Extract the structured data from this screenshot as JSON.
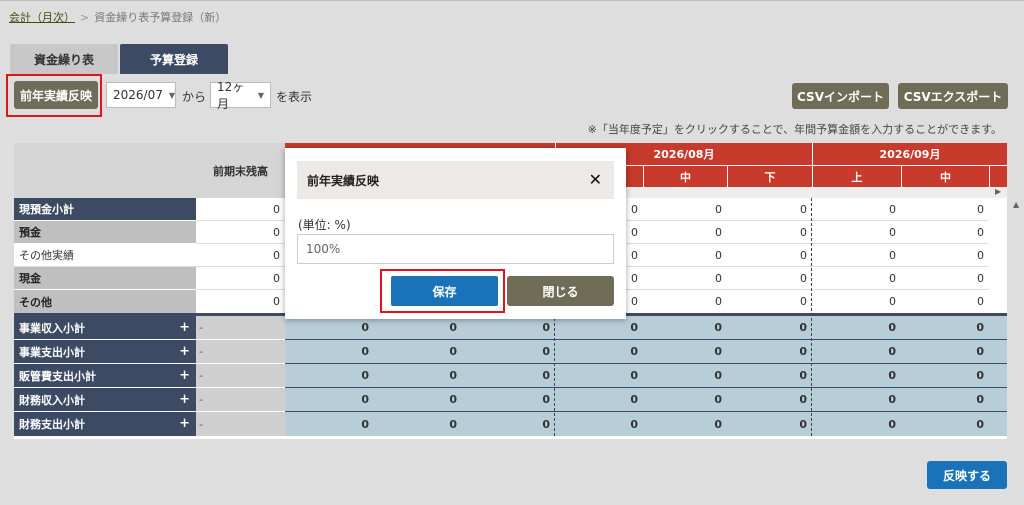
{
  "breadcrumb": {
    "root": "会計（月次）",
    "separator": ">",
    "current": "資金繰り表予算登録（新）"
  },
  "tabs": [
    {
      "label": "資金繰り表"
    },
    {
      "label": "予算登録"
    }
  ],
  "toolbar": {
    "prev_year_label": "前年実績反映",
    "start_month": "2026/07",
    "from_label": "から",
    "period": "12ヶ月",
    "display_label": "を表示",
    "csv_import_label": "CSVインポート",
    "csv_export_label": "CSVエクスポート"
  },
  "note": "※「当年度予定」をクリックすることで、年間予算金額を入力することができます。",
  "grid": {
    "opening_balance_header": "前期末残高",
    "months": [
      {
        "label": "2026/08月"
      },
      {
        "label": "2026/09月"
      }
    ],
    "periods": {
      "early": "上",
      "mid": "中",
      "late": "下"
    },
    "rows": [
      {
        "label": "現預金小計",
        "opening": "0",
        "values": [
          "0",
          "0",
          "0",
          "0",
          "0"
        ]
      },
      {
        "label": "預金",
        "opening": "0",
        "values": [
          "0",
          "0",
          "0",
          "0",
          "0"
        ]
      },
      {
        "label": "その他実績",
        "opening": "0",
        "values": [
          "0",
          "0",
          "0",
          "0",
          "0"
        ]
      },
      {
        "label": "現金",
        "opening": "0",
        "values": [
          "0",
          "0",
          "0",
          "0",
          "0"
        ]
      },
      {
        "label": "その他",
        "opening": "0",
        "values": [
          "0",
          "0",
          "0",
          "0",
          "0"
        ]
      }
    ],
    "subtotals": [
      {
        "label": "事業収入小計",
        "opening": "-",
        "values": [
          "0",
          "0",
          "0",
          "0",
          "0",
          "0",
          "0",
          "0"
        ]
      },
      {
        "label": "事業支出小計",
        "opening": "-",
        "values": [
          "0",
          "0",
          "0",
          "0",
          "0",
          "0",
          "0",
          "0"
        ]
      },
      {
        "label": "販管費支出小計",
        "opening": "-",
        "values": [
          "0",
          "0",
          "0",
          "0",
          "0",
          "0",
          "0",
          "0"
        ]
      },
      {
        "label": "財務収入小計",
        "opening": "-",
        "values": [
          "0",
          "0",
          "0",
          "0",
          "0",
          "0",
          "0",
          "0"
        ]
      },
      {
        "label": "財務支出小計",
        "opening": "-",
        "values": [
          "0",
          "0",
          "0",
          "0",
          "0",
          "0",
          "0",
          "0"
        ]
      }
    ],
    "expand_symbol": "+"
  },
  "modal": {
    "title": "前年実績反映",
    "close_symbol": "✕",
    "unit_label": "(単位: %)",
    "value": "100%",
    "save_label": "保存",
    "close_label": "閉じる"
  },
  "footer": {
    "reflect_label": "反映する"
  },
  "colors": {
    "navy": "#3c4b63",
    "red_header": "#c83a2c",
    "blue_button": "#1a73b8",
    "olive_button": "#6f6c57",
    "highlight": "#e0141e"
  }
}
